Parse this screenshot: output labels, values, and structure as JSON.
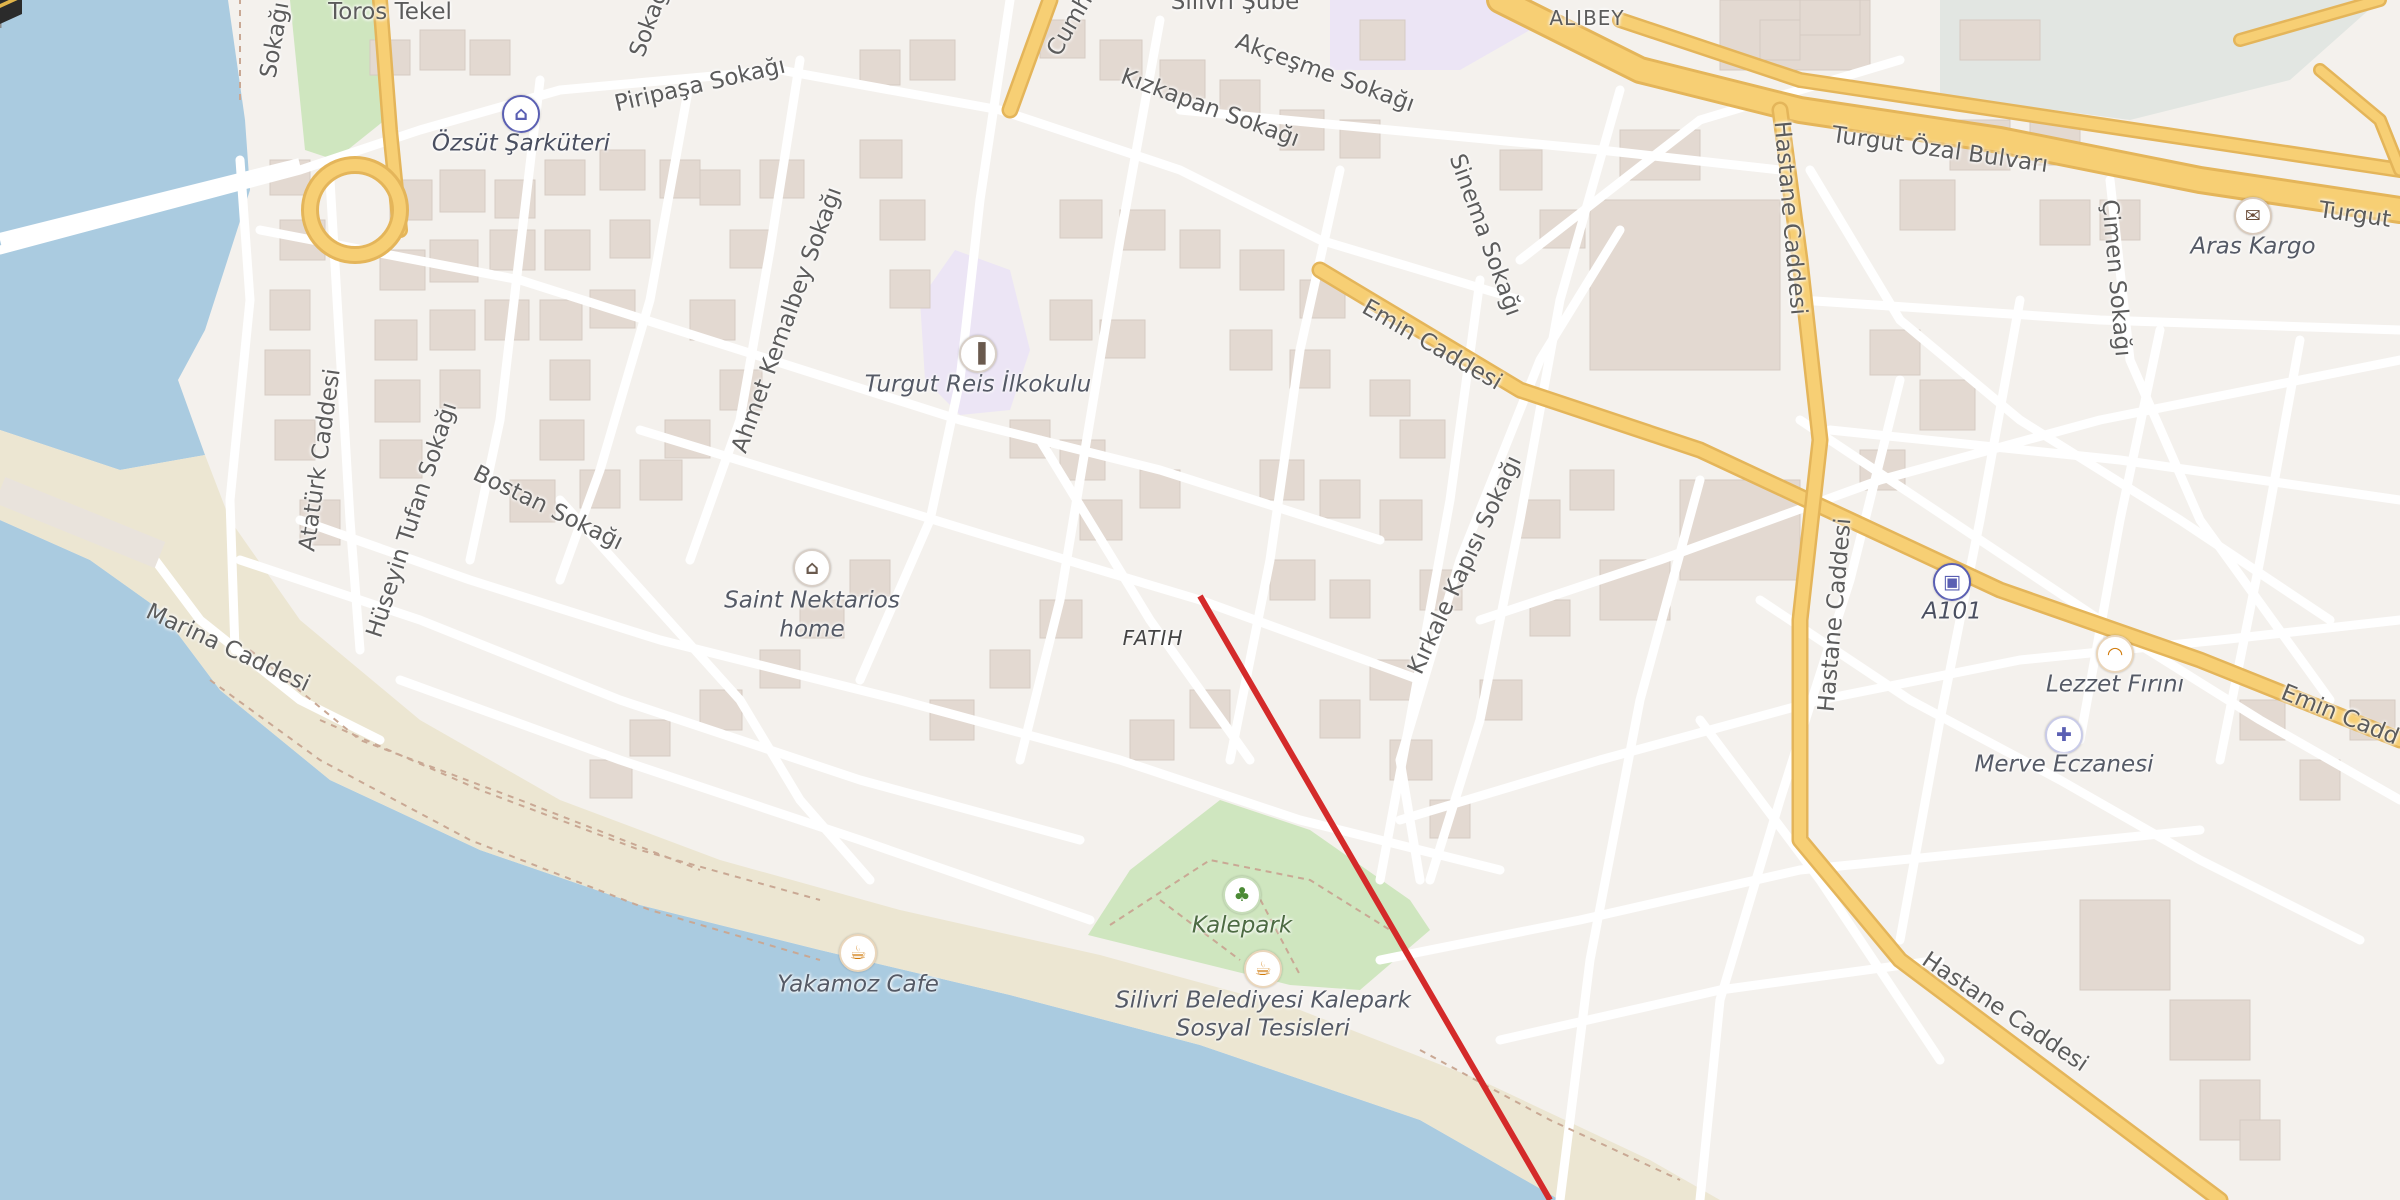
{
  "map": {
    "colors": {
      "water": "#aacbe0",
      "land": "#f4f1ed",
      "beach": "#ece6d2",
      "park": "#cfe6bf",
      "school": "#ece5f5",
      "building": "#e3d9d1",
      "minor_road": "#ffffff",
      "major_road": "#f7cf74",
      "major_road_casing": "#e4b55a",
      "qibla_line": "#d42a2a",
      "pin": "#e2306a"
    },
    "district_label": "FATIH",
    "streets": [
      "Toros Tekel",
      "Piripaşa Sokağı",
      "Akçeşme Sokağı",
      "Kızkapan Sokağı",
      "Sinema Sokağı",
      "Turgut Özal Bulvarı",
      "Turgut",
      "Hastane Caddesi",
      "Emin Caddesi",
      "Emin Cadd",
      "Çimen Sokağı",
      "Ahmet Kemalbey Sokağı",
      "Atatürk Caddesi",
      "Hüseyin Tufan Sokağı",
      "Bostan Sokağı",
      "Marina Caddesi",
      "Kırkale Kapısı Sokağı",
      "Hastane Caddesi",
      "Hastane Caddesi",
      "Cumh",
      "Sokağı",
      "Sokağı",
      "ALIBEY",
      "Silivri Şube"
    ],
    "pois": [
      {
        "name": "Özsüt Şarküteri",
        "icon": "shopping-basket-icon",
        "category": "shop"
      },
      {
        "name": "Turgut Reis İlkokulu",
        "icon": "school-icon",
        "category": "school"
      },
      {
        "name": "Saint Nektarios home",
        "line1": "Saint Nektarios",
        "line2": "home",
        "icon": "historic-building-icon",
        "category": "historic"
      },
      {
        "name": "Kalepark",
        "icon": "tree-icon",
        "category": "park"
      },
      {
        "name": "Silivri Belediyesi Kalepark Sosyal Tesisleri",
        "line1": "Silivri Belediyesi Kalepark",
        "line2": "Sosyal Tesisleri",
        "icon": "cafe-cup-icon",
        "category": "cafe"
      },
      {
        "name": "Yakamoz Cafe",
        "icon": "cafe-cup-icon",
        "category": "cafe"
      },
      {
        "name": "A101",
        "icon": "shopping-cart-icon",
        "category": "shop"
      },
      {
        "name": "Lezzet Fırını",
        "icon": "bakery-croissant-icon",
        "category": "bakery"
      },
      {
        "name": "Merve Eczanesi",
        "icon": "pharmacy-mortar-icon",
        "category": "pharmacy"
      },
      {
        "name": "Aras Kargo",
        "icon": "envelope-icon",
        "category": "post"
      }
    ],
    "markers": {
      "location_pin": "location-pin-icon",
      "qibla": "kaaba-icon"
    }
  }
}
